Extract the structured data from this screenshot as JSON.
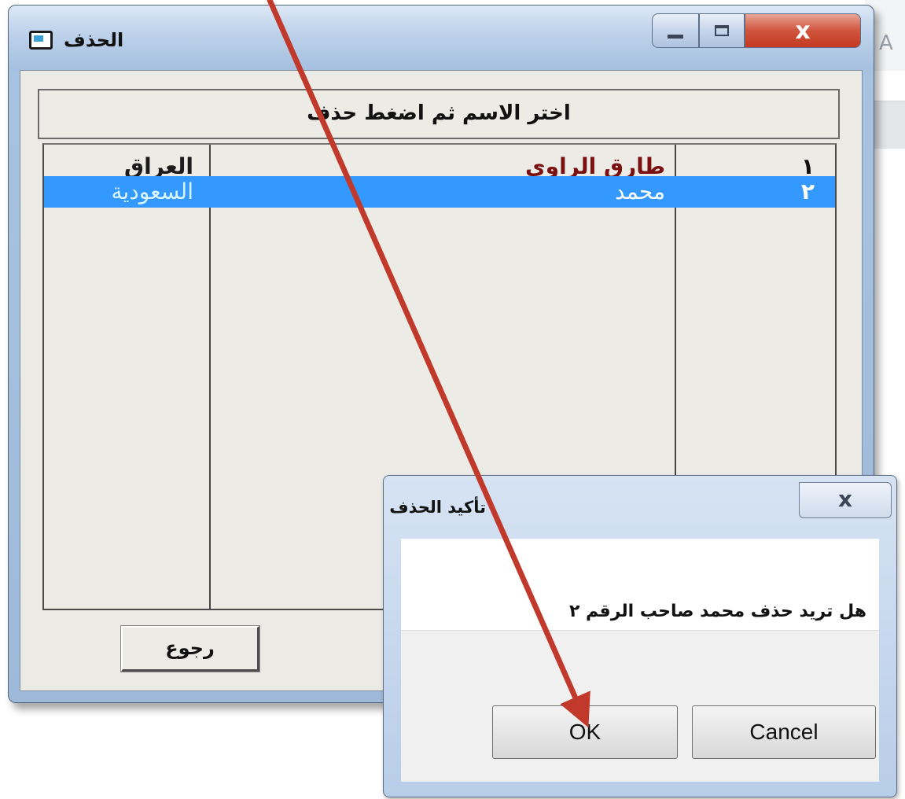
{
  "background": {
    "partial_letter": "A"
  },
  "main_window": {
    "title": "الحذف",
    "close_glyph": "x",
    "instruction": "اختر الاسم ثم اضغط حذف",
    "rows": [
      {
        "number": "١",
        "name": "طارق الراوي",
        "country": "العراق",
        "selected": false
      },
      {
        "number": "٢",
        "name": "محمد",
        "country": "السعودية",
        "selected": true
      }
    ],
    "back_button": "رجوع"
  },
  "dialog": {
    "title": "تأكيد الحذف",
    "close_glyph": "x",
    "message": "هل تريد حذف  محمد صاحب الرقم ٢",
    "ok_label": "OK",
    "cancel_label": "Cancel"
  },
  "colors": {
    "selection": "#3399ff",
    "annotation_arrow": "#c0392b"
  }
}
